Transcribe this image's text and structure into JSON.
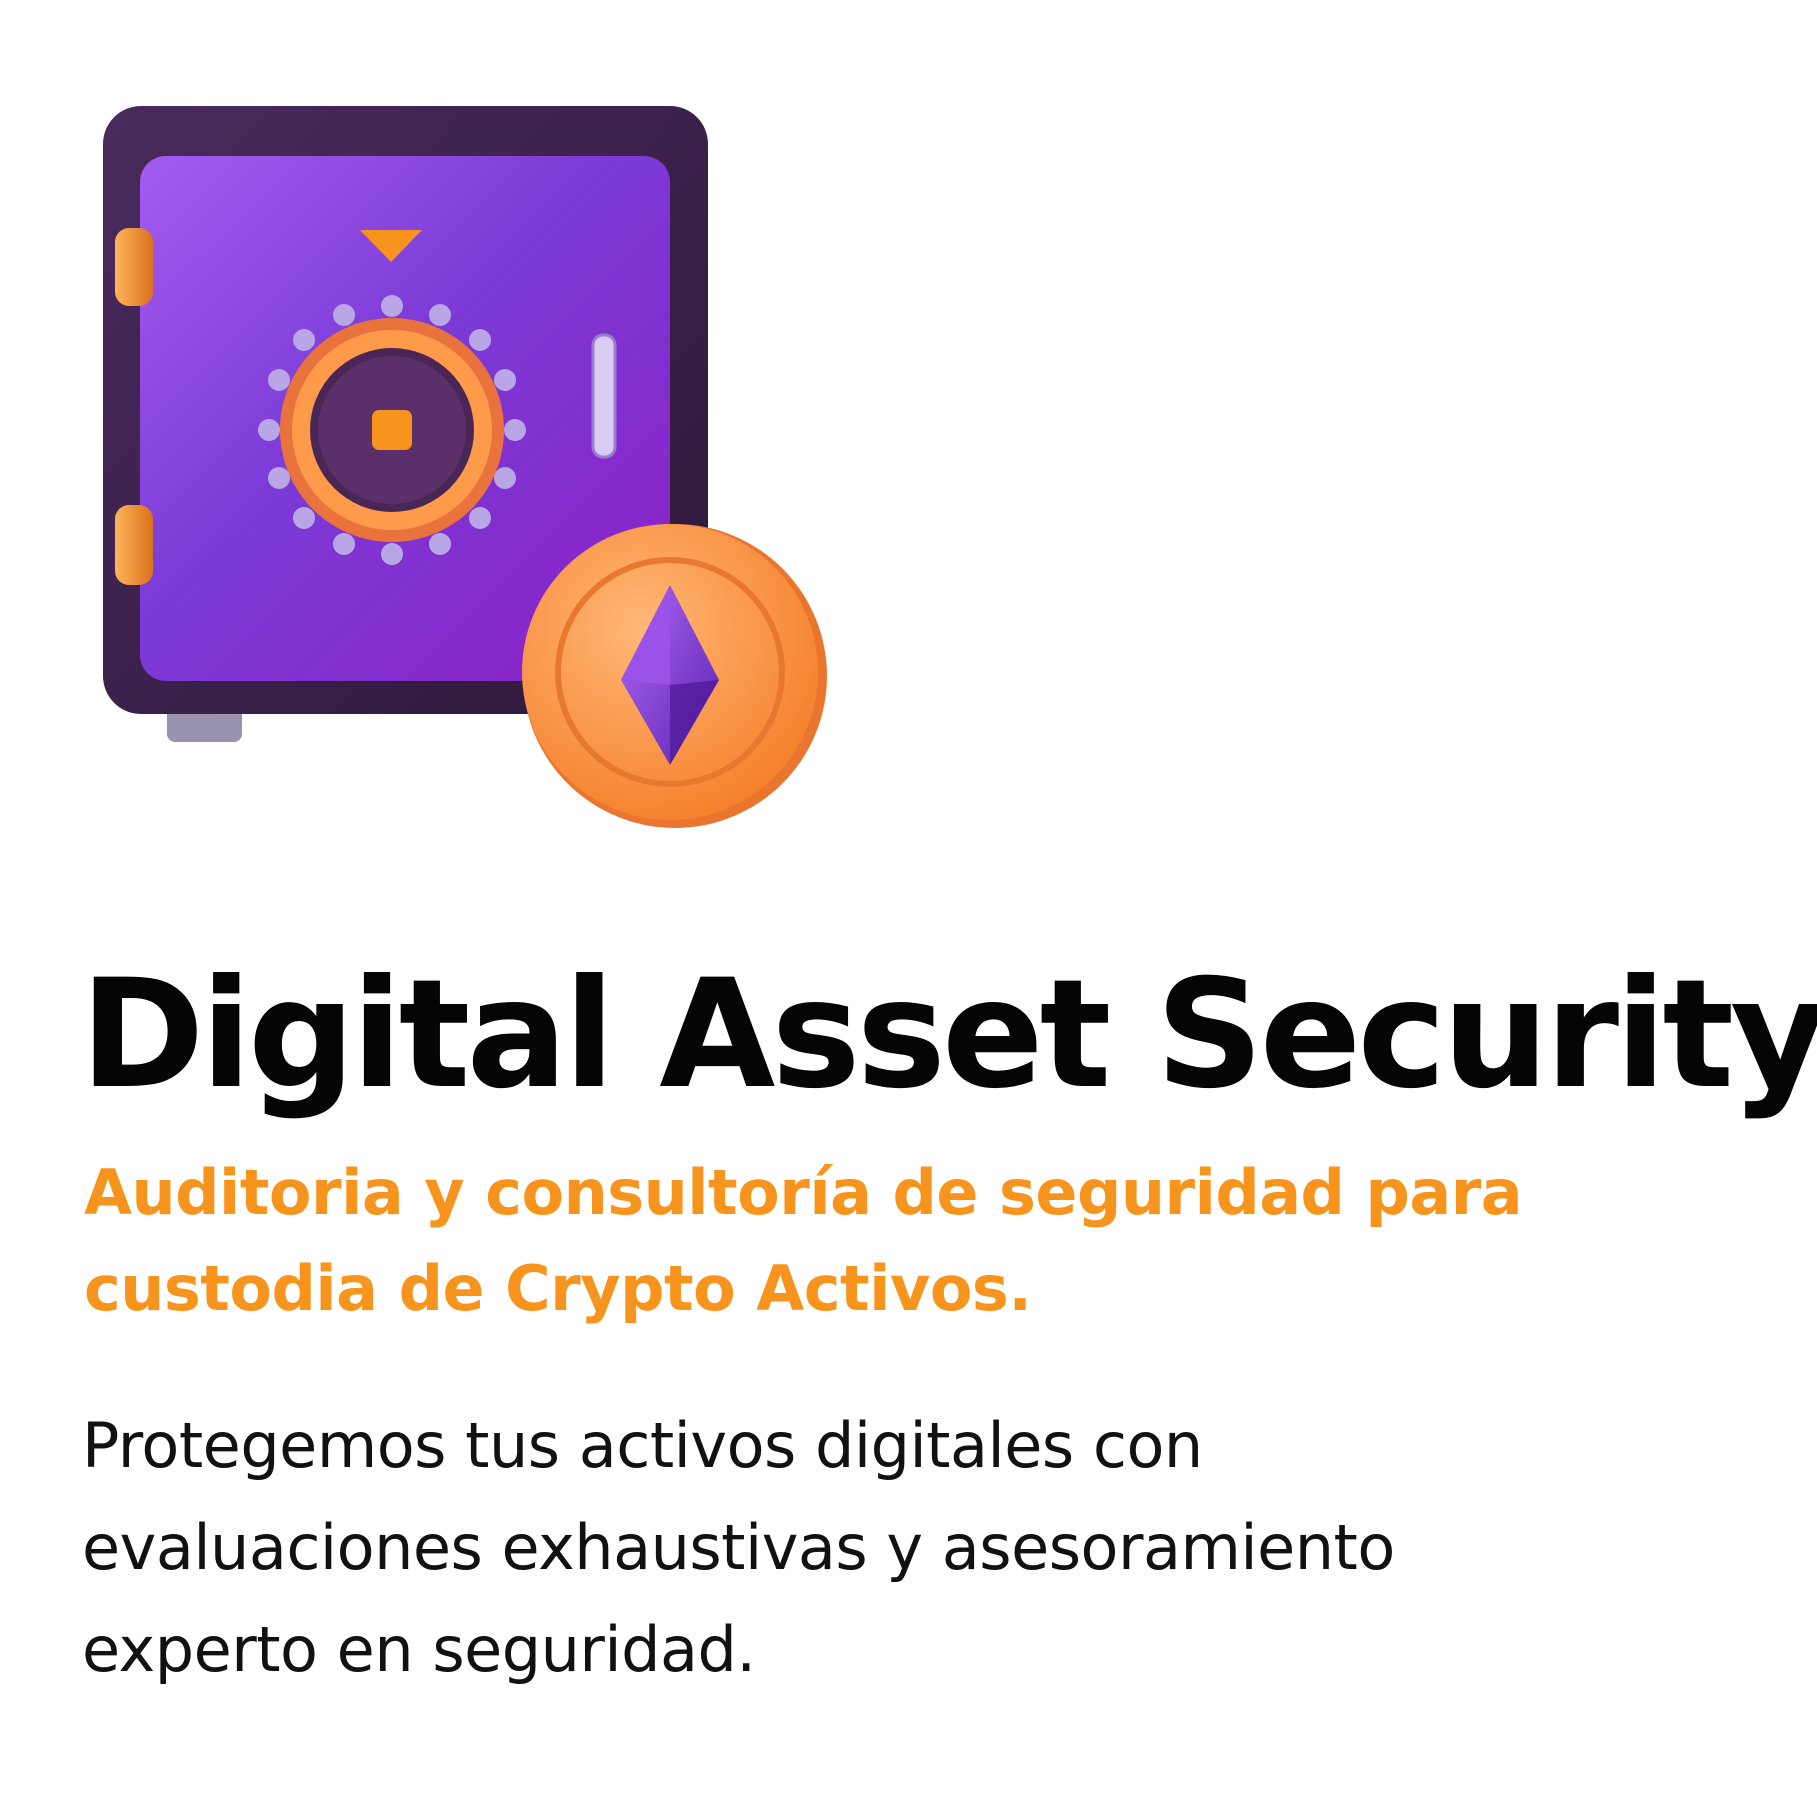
{
  "illustration": {
    "safe_icon": "safe-icon",
    "coin_icon": "ethereum-coin-icon",
    "colors": {
      "safe_body": "#3a2147",
      "safe_door": "#8a2ed6",
      "accent_orange": "#f7941d",
      "gem_purple": "#7a2fd0"
    }
  },
  "content": {
    "title": "Digital Asset Security",
    "subtitle_lines": [
      "Auditoria y consultoría de seguridad para",
      "custodia de Crypto Activos."
    ],
    "description_lines": [
      "Protegemos tus activos digitales con",
      "evaluaciones exhaustivas y asesoramiento",
      "experto en seguridad."
    ]
  },
  "colors": {
    "title": "#050505",
    "subtitle": "#f7941d",
    "body": "#111111",
    "background": "#ffffff"
  }
}
